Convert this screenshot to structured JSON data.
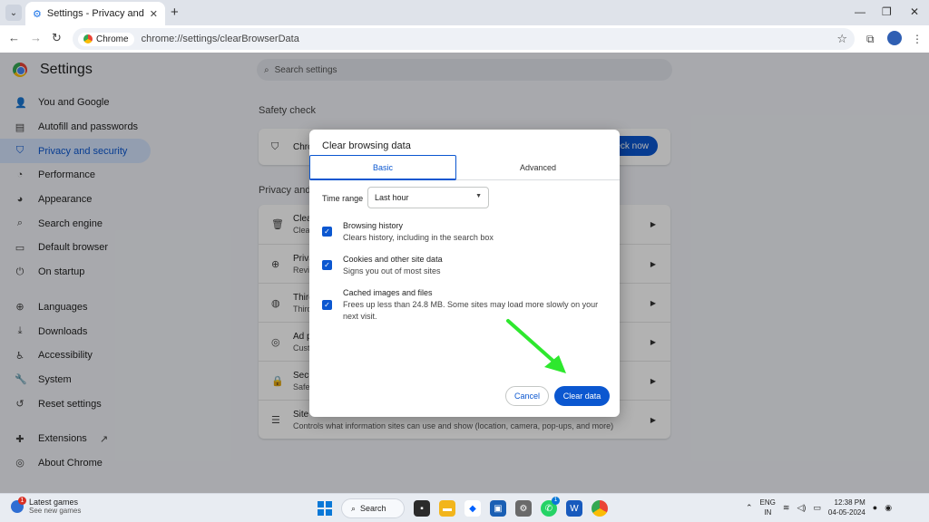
{
  "browser": {
    "tab_title": "Settings - Privacy and security",
    "chip_label": "Chrome",
    "url": "chrome://settings/clearBrowserData"
  },
  "settings": {
    "title": "Settings",
    "search_placeholder": "Search settings",
    "nav": [
      {
        "label": "You and Google",
        "icon": "person-icon"
      },
      {
        "label": "Autofill and passwords",
        "icon": "clipboard-icon"
      },
      {
        "label": "Privacy and security",
        "icon": "shield-icon",
        "active": true
      },
      {
        "label": "Performance",
        "icon": "gauge-icon"
      },
      {
        "label": "Appearance",
        "icon": "palette-icon"
      },
      {
        "label": "Search engine",
        "icon": "search-icon"
      },
      {
        "label": "Default browser",
        "icon": "browser-icon"
      },
      {
        "label": "On startup",
        "icon": "power-icon"
      },
      {
        "label": "Languages",
        "icon": "globe-icon"
      },
      {
        "label": "Downloads",
        "icon": "download-icon"
      },
      {
        "label": "Accessibility",
        "icon": "accessibility-icon"
      },
      {
        "label": "System",
        "icon": "wrench-icon"
      },
      {
        "label": "Reset settings",
        "icon": "reset-icon"
      },
      {
        "label": "Extensions",
        "icon": "puzzle-icon"
      },
      {
        "label": "About Chrome",
        "icon": "chrome-icon"
      }
    ],
    "safety_heading": "Safety check",
    "safety_row_text": "Chro",
    "safety_button": "eck now",
    "privacy_heading": "Privacy and s",
    "privacy_rows": [
      {
        "t1": "Clear",
        "t2": "Clear",
        "icon": "trash-icon"
      },
      {
        "t1": "Priva",
        "t2": "Revie",
        "icon": "plus-circle-icon"
      },
      {
        "t1": "Third",
        "t2": "Third",
        "icon": "cookie-icon"
      },
      {
        "t1": "Ad p",
        "t2": "Custo",
        "icon": "ad-icon"
      },
      {
        "t1": "Secu",
        "t2": "Safe",
        "icon": "lock-icon"
      },
      {
        "t1": "Site",
        "t2": "Controls what information sites can use and show (location, camera, pop-ups, and more)",
        "icon": "sliders-icon"
      }
    ]
  },
  "dialog": {
    "title": "Clear browsing data",
    "tab_basic": "Basic",
    "tab_advanced": "Advanced",
    "time_range_label": "Time range",
    "time_range_value": "Last hour",
    "items": [
      {
        "title": "Browsing history",
        "desc": "Clears history, including in the search box",
        "checked": true
      },
      {
        "title": "Cookies and other site data",
        "desc": "Signs you out of most sites",
        "checked": true
      },
      {
        "title": "Cached images and files",
        "desc": "Frees up less than 24.8 MB. Some sites may load more slowly on your next visit.",
        "checked": true
      }
    ],
    "cancel_label": "Cancel",
    "clear_label": "Clear data",
    "accent": "#0b57d0"
  },
  "taskbar": {
    "widget_title": "Latest games",
    "widget_sub": "See new games",
    "widget_badge": "1",
    "search_label": "Search",
    "whatsapp_badge": "1",
    "lang_line1": "ENG",
    "lang_line2": "IN",
    "time": "12:38 PM",
    "date": "04-05-2024"
  }
}
